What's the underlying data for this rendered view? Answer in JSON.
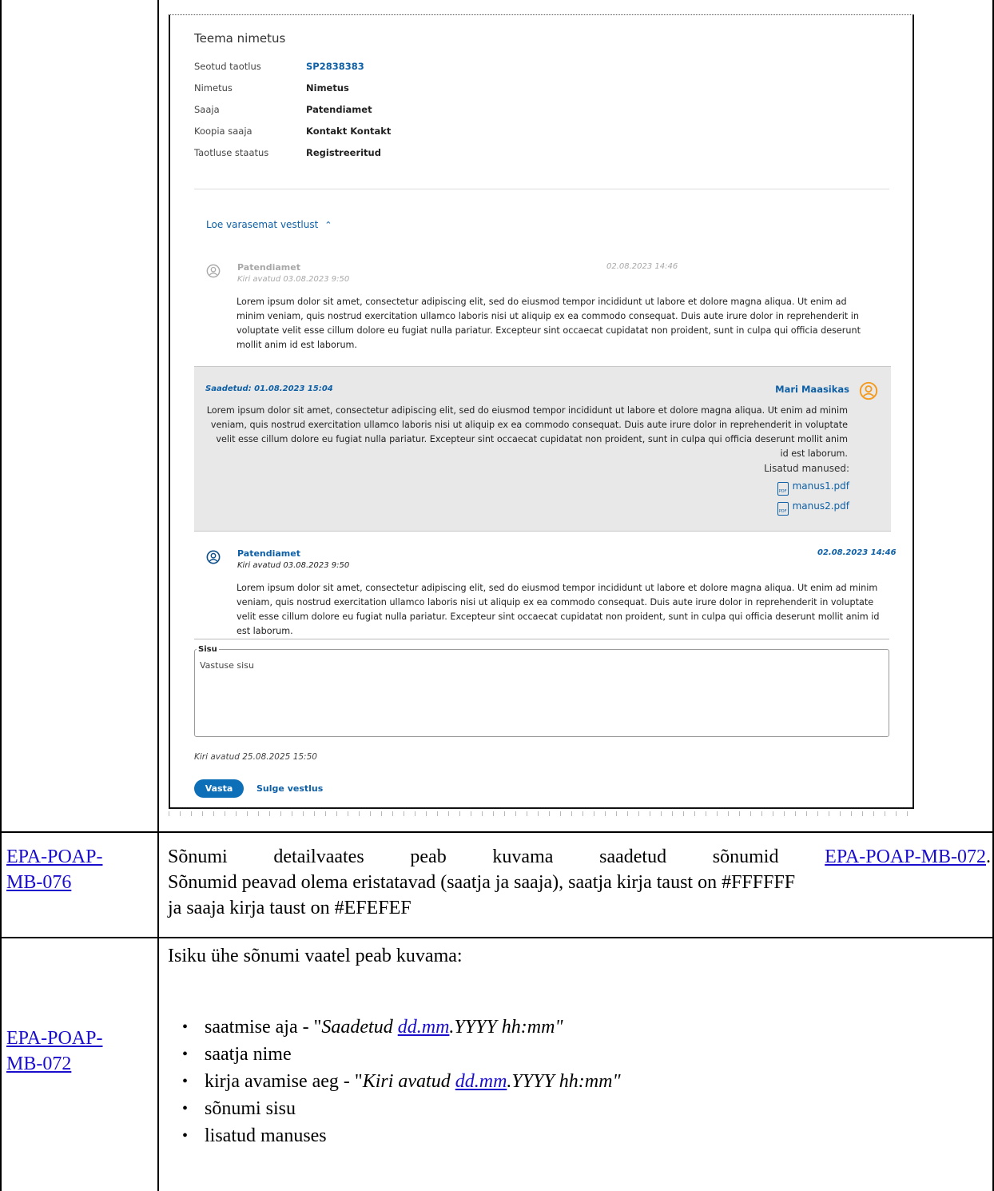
{
  "screenshot": {
    "title": "Teema nimetus",
    "info": [
      {
        "label": "Seotud taotlus",
        "value": "SP2838383"
      },
      {
        "label": "Nimetus",
        "value": "Nimetus"
      },
      {
        "label": "Saaja",
        "value": "Patendiamet"
      },
      {
        "label": "Koopia saaja",
        "value": "Kontakt Kontakt"
      },
      {
        "label": "Taotluse staatus",
        "value": "Registreeritud"
      }
    ],
    "earlier_link": "Loe varasemat vestlust",
    "messages": [
      {
        "name": "Patendiamet",
        "opened": "Kiri avatud 03.08.2023 9:50",
        "stamp": "02.08.2023 14:46",
        "body": "Lorem ipsum dolor sit amet, consectetur adipiscing elit, sed do eiusmod tempor incididunt ut labore et dolore magna aliqua. Ut enim ad minim veniam, quis nostrud exercitation ullamco laboris nisi ut aliquip ex ea commodo consequat. Duis aute irure dolor in reprehenderit in voluptate velit esse cillum dolore eu fugiat nulla pariatur. Excepteur sint occaecat cupidatat non proident, sunt in culpa qui officia deserunt mollit anim id est laborum."
      },
      {
        "name": "Mari Maasikas",
        "stamp": "Saadetud: 01.08.2023 15:04",
        "body": "Lorem ipsum dolor sit amet, consectetur adipiscing elit, sed do eiusmod tempor incididunt ut labore et dolore magna aliqua. Ut enim ad minim veniam, quis nostrud exercitation ullamco laboris nisi ut aliquip ex ea commodo consequat. Duis aute irure dolor in reprehenderit in voluptate velit esse cillum dolore eu fugiat nulla pariatur. Excepteur sint occaecat cupidatat non proident, sunt in culpa qui officia deserunt mollit anim id est laborum.",
        "attachments_label": "Lisatud manused:",
        "attachments": [
          "manus1.pdf",
          "manus2.pdf"
        ]
      },
      {
        "name": "Patendiamet",
        "opened": "Kiri avatud 03.08.2023 9:50",
        "stamp": "02.08.2023 14:46",
        "body": "Lorem ipsum dolor sit amet, consectetur adipiscing elit, sed do eiusmod tempor incididunt ut labore et dolore magna aliqua. Ut enim ad minim veniam, quis nostrud exercitation ullamco laboris nisi ut aliquip ex ea commodo consequat. Duis aute irure dolor in reprehenderit in voluptate velit esse cillum dolore eu fugiat nulla pariatur. Excepteur sint occaecat cupidatat non proident, sunt in culpa qui officia deserunt mollit anim id est laborum."
      }
    ],
    "pdf_icon_text": "PDF",
    "reply_field_legend": "Sisu",
    "reply_field_placeholder": "Vastuse sisu",
    "footer_opened": "Kiri avatud 25.08.2025 15:50",
    "reply_button": "Vasta",
    "close_link": "Sulge vestlus"
  },
  "rows": [
    {
      "id": [
        "EPA-POAP-",
        "MB-076"
      ],
      "text_a": "Sõnumi detailvaates peab kuvama saadetud sõnumid ",
      "link": "EPA-POAP-MB-072",
      "text_b": ".",
      "line2": "Sõnumid peavad olema eristatavad (saatja ja saaja), saatja kirja taust on #FFFFFF",
      "line3": "ja saaja kirja taust on #EFEFEF"
    },
    {
      "id": [
        "EPA-POAP-",
        "MB-072"
      ],
      "intro": "Isiku ühe sõnumi vaatel peab kuvama:",
      "bullets": [
        {
          "pre": "saatmise aja - \"",
          "it1": "Saadetud ",
          "link": "dd.mm",
          "it2": ".YYYY hh:mm\""
        },
        {
          "text": "saatja nime"
        },
        {
          "pre": "kirja avamise aeg - \"",
          "it1": "Kiri avatud ",
          "link": "dd.mm",
          "it2": ".YYYY hh:mm\""
        },
        {
          "text": "sõnumi sisu"
        },
        {
          "text": "lisatud manuses"
        }
      ]
    }
  ],
  "colors": {
    "link": "#0d5fa6",
    "received_bg": "#e8e8e8",
    "orange": "#f39a1f",
    "button": "#0d6fb8"
  }
}
